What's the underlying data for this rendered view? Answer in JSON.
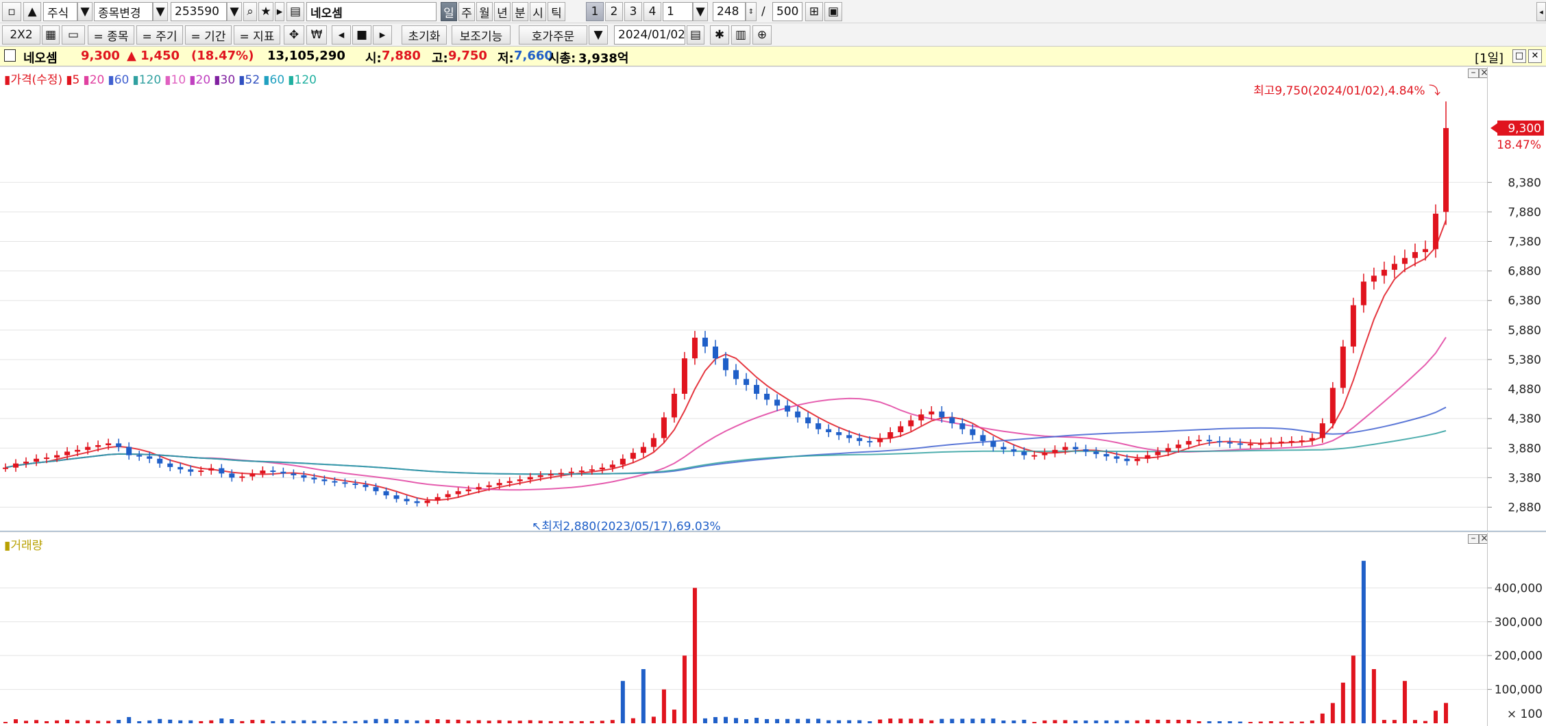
{
  "toolbar1": {
    "market": "주식",
    "change_symbol": "종목변경",
    "code": "253590",
    "stock_name": "네오셈",
    "periods": [
      "일",
      "주",
      "월",
      "년",
      "분",
      "시",
      "틱"
    ],
    "intervals": [
      "1",
      "2",
      "3",
      "4"
    ],
    "interval_value": "1",
    "count_shown": "248",
    "count_separator": "/",
    "count_total": "500"
  },
  "toolbar2": {
    "layout": "2X2",
    "symbol_btn": "= 종목",
    "period_btn": "= 주기",
    "range_btn": "= 기간",
    "indicator_btn": "= 지표",
    "reset_btn": "초기화",
    "aux_btn": "보조기능",
    "quote_order_btn": "호가주문",
    "date": "2024/01/02"
  },
  "info": {
    "name": "네오셈",
    "price": "9,300",
    "change": "▲ 1,450",
    "change_pct": "(18.47%)",
    "volume": "13,105,290",
    "open_label": "시:",
    "open": "7,880",
    "high_label": "고:",
    "high": "9,750",
    "low_label": "저:",
    "low": "7,660",
    "mcap_label": "시총:",
    "mcap": "3,938억",
    "period_tag": "[1일]"
  },
  "price_legend": [
    {
      "text": "가격(수정)",
      "color": "#e0141e"
    },
    {
      "text": "5",
      "color": "#e0141e"
    },
    {
      "text": "20",
      "color": "#e040a0"
    },
    {
      "text": "60",
      "color": "#4060d0"
    },
    {
      "text": "120",
      "color": "#30a0a0"
    },
    {
      "text": "10",
      "color": "#e060c0"
    },
    {
      "text": "20",
      "color": "#c040c0"
    },
    {
      "text": "30",
      "color": "#8020a0"
    },
    {
      "text": "52",
      "color": "#3050c0"
    },
    {
      "text": "60",
      "color": "#20a0c0"
    },
    {
      "text": "120",
      "color": "#20b0a0"
    }
  ],
  "volume_legend": {
    "text": "거래량",
    "color": "#b8a000"
  },
  "annotations": {
    "high_text": "최고9,750(2024/01/02),4.84%",
    "low_text": "최저2,880(2023/05/17),69.03%"
  },
  "current_tag": {
    "price": "9,300",
    "pct": "18.47%"
  },
  "colors": {
    "up": "#e0141e",
    "down": "#1f5fc8",
    "grid": "#e3e3e3"
  },
  "chart_data": [
    {
      "type": "candlestick",
      "title": "가격(수정)",
      "y_ticks": [
        2880,
        3380,
        3880,
        4380,
        4880,
        5380,
        5880,
        6380,
        6880,
        7380,
        7880,
        8380
      ],
      "ylim": [
        2700,
        10100
      ],
      "x_range": [
        "2023/01/02",
        "2024/01/02"
      ],
      "last": {
        "open": 7880,
        "high": 9750,
        "low": 7660,
        "close": 9300
      },
      "period_high": {
        "value": 9750,
        "date": "2024/01/02"
      },
      "period_low": {
        "value": 2880,
        "date": "2023/05/17"
      },
      "close_series": [
        3550,
        3620,
        3650,
        3700,
        3720,
        3760,
        3820,
        3850,
        3900,
        3930,
        3960,
        3900,
        3760,
        3740,
        3700,
        3620,
        3560,
        3520,
        3480,
        3500,
        3540,
        3450,
        3380,
        3400,
        3450,
        3500,
        3480,
        3450,
        3420,
        3380,
        3350,
        3320,
        3300,
        3280,
        3260,
        3220,
        3150,
        3080,
        3020,
        2980,
        2950,
        2990,
        3050,
        3100,
        3150,
        3180,
        3220,
        3250,
        3290,
        3320,
        3350,
        3390,
        3420,
        3440,
        3460,
        3480,
        3500,
        3520,
        3550,
        3600,
        3700,
        3800,
        3900,
        4050,
        4400,
        4800,
        5400,
        5750,
        5600,
        5400,
        5200,
        5050,
        4950,
        4800,
        4700,
        4600,
        4500,
        4400,
        4300,
        4200,
        4150,
        4100,
        4050,
        4000,
        3980,
        4050,
        4150,
        4250,
        4350,
        4450,
        4500,
        4400,
        4300,
        4200,
        4100,
        4000,
        3900,
        3860,
        3820,
        3760,
        3760,
        3800,
        3850,
        3900,
        3860,
        3820,
        3780,
        3740,
        3700,
        3660,
        3700,
        3760,
        3820,
        3880,
        3940,
        4000,
        4020,
        4000,
        3980,
        3960,
        3950,
        3950,
        3960,
        3980,
        3990,
        4000,
        4010,
        4050,
        4300,
        4900,
        5600,
        6300,
        6700,
        6800,
        6900,
        7000,
        7100,
        7200,
        7250,
        7850,
        9300
      ],
      "ma_series": [
        {
          "name": "5",
          "color": "#e0141e"
        },
        {
          "name": "20",
          "color": "#e040a0"
        },
        {
          "name": "60",
          "color": "#4060d0"
        },
        {
          "name": "120",
          "color": "#30a0a0"
        }
      ]
    },
    {
      "type": "bar",
      "title": "거래량",
      "y_ticks": [
        100000,
        200000,
        300000,
        400000
      ],
      "tick_labels": [
        "100,000",
        "200,000",
        "300,000",
        "400,000"
      ],
      "unit_label": "× 100",
      "ylim": [
        0,
        510000
      ],
      "peak_volume": 480000,
      "spikes": [
        {
          "value": 125000,
          "color": "blue"
        },
        {
          "value": 160000,
          "color": "blue"
        },
        {
          "value": 100000,
          "color": "red"
        },
        {
          "value": 200000,
          "color": "red"
        },
        {
          "value": 400000,
          "color": "red"
        },
        {
          "value": 120000,
          "color": "red"
        },
        {
          "value": 200000,
          "color": "red"
        },
        {
          "value": 480000,
          "color": "blue"
        },
        {
          "value": 160000,
          "color": "red"
        },
        {
          "value": 125000,
          "color": "red"
        }
      ]
    }
  ]
}
